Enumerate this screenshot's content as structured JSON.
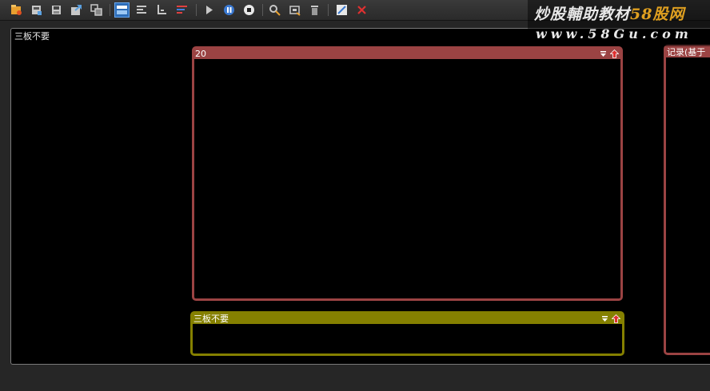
{
  "toolbar": {
    "buttons": [
      {
        "name": "open-icon",
        "color": "#e8a030"
      },
      {
        "name": "save-as-icon",
        "color": "#c8c8c8"
      },
      {
        "name": "save-icon",
        "color": "#c8c8c8"
      },
      {
        "name": "export-icon",
        "color": "#5aa0e0"
      },
      {
        "name": "copy-icon",
        "color": "#c8c8c8"
      },
      {
        "name": "layout-single-icon",
        "active": true
      },
      {
        "name": "align-left-icon"
      },
      {
        "name": "align-bottom-icon"
      },
      {
        "name": "color-bars-icon",
        "colors": [
          "#e04040",
          "#4080e0"
        ]
      },
      {
        "name": "play-icon"
      },
      {
        "name": "pause-icon"
      },
      {
        "name": "stop-icon"
      },
      {
        "name": "search-user-icon"
      },
      {
        "name": "fit-icon"
      },
      {
        "name": "trash-icon"
      },
      {
        "name": "edit-icon"
      },
      {
        "name": "close-icon",
        "color": "#e03030"
      }
    ]
  },
  "watermark": {
    "line1_prefix": "炒股輔助教材",
    "line1_accent": "58股网",
    "line2": "www.58Gu.com"
  },
  "main_panel": {
    "title": "三板不要"
  },
  "windows": [
    {
      "id": "win-20",
      "title": "20",
      "color": "#9b4343"
    },
    {
      "id": "win-sanban",
      "title": "三板不要",
      "color": "#858000"
    },
    {
      "id": "win-record",
      "title": "记录(基于",
      "color": "#9b4343"
    }
  ]
}
